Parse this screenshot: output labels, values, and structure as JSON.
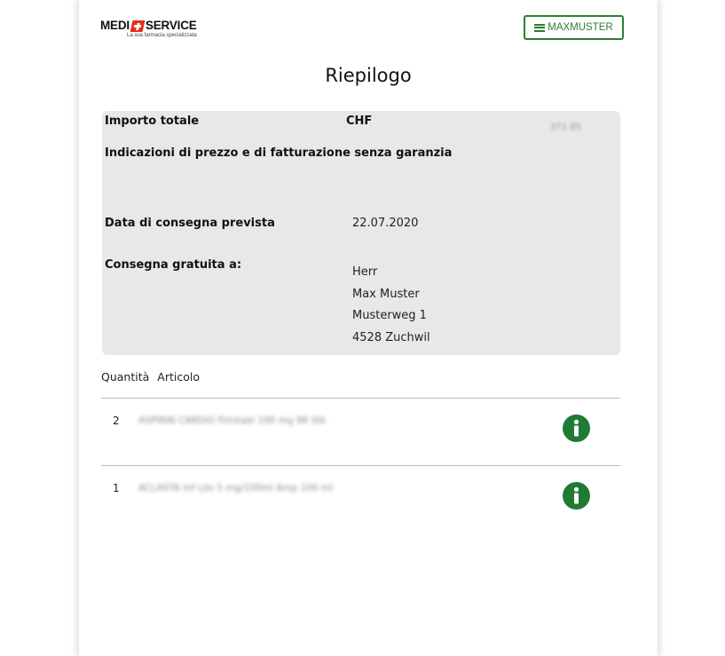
{
  "header": {
    "logo": {
      "left_text": "MEDI",
      "right_text": "SERVICE",
      "tagline": "La sua farmacia specializzata"
    },
    "user_button_label": "MAXMUSTER",
    "user_button_icon": "menu-icon"
  },
  "page_title": "Riepilogo",
  "summary": {
    "total_label": "Importo totale",
    "currency": "CHF",
    "amount": "371.85",
    "price_note": "Indicazioni di prezzo e di fatturazione senza garanzia",
    "delivery_date_label": "Data di consegna prevista",
    "delivery_date": "22.07.2020",
    "shipping_label": "Consegna gratuita a:",
    "address": {
      "salutation": "Herr",
      "name": "Max Muster",
      "street": "Musterweg 1",
      "city": "4528 Zuchwil"
    }
  },
  "list": {
    "columns": [
      "Quantità",
      "Articolo"
    ],
    "items": [
      {
        "quantity": "2",
        "article": "ASPIRIN CARDIO Filmtabl 100 mg 98 Stk",
        "info_icon": "info-icon"
      },
      {
        "quantity": "1",
        "article": "ACLASTA Inf Lös 5 mg/100ml Amp 100 ml",
        "info_icon": "info-icon"
      }
    ]
  },
  "colors": {
    "accent_green": "#2e7d32",
    "info_green": "#1f7a34",
    "logo_red": "#e0301e",
    "summary_background": "#e8e8e8"
  }
}
